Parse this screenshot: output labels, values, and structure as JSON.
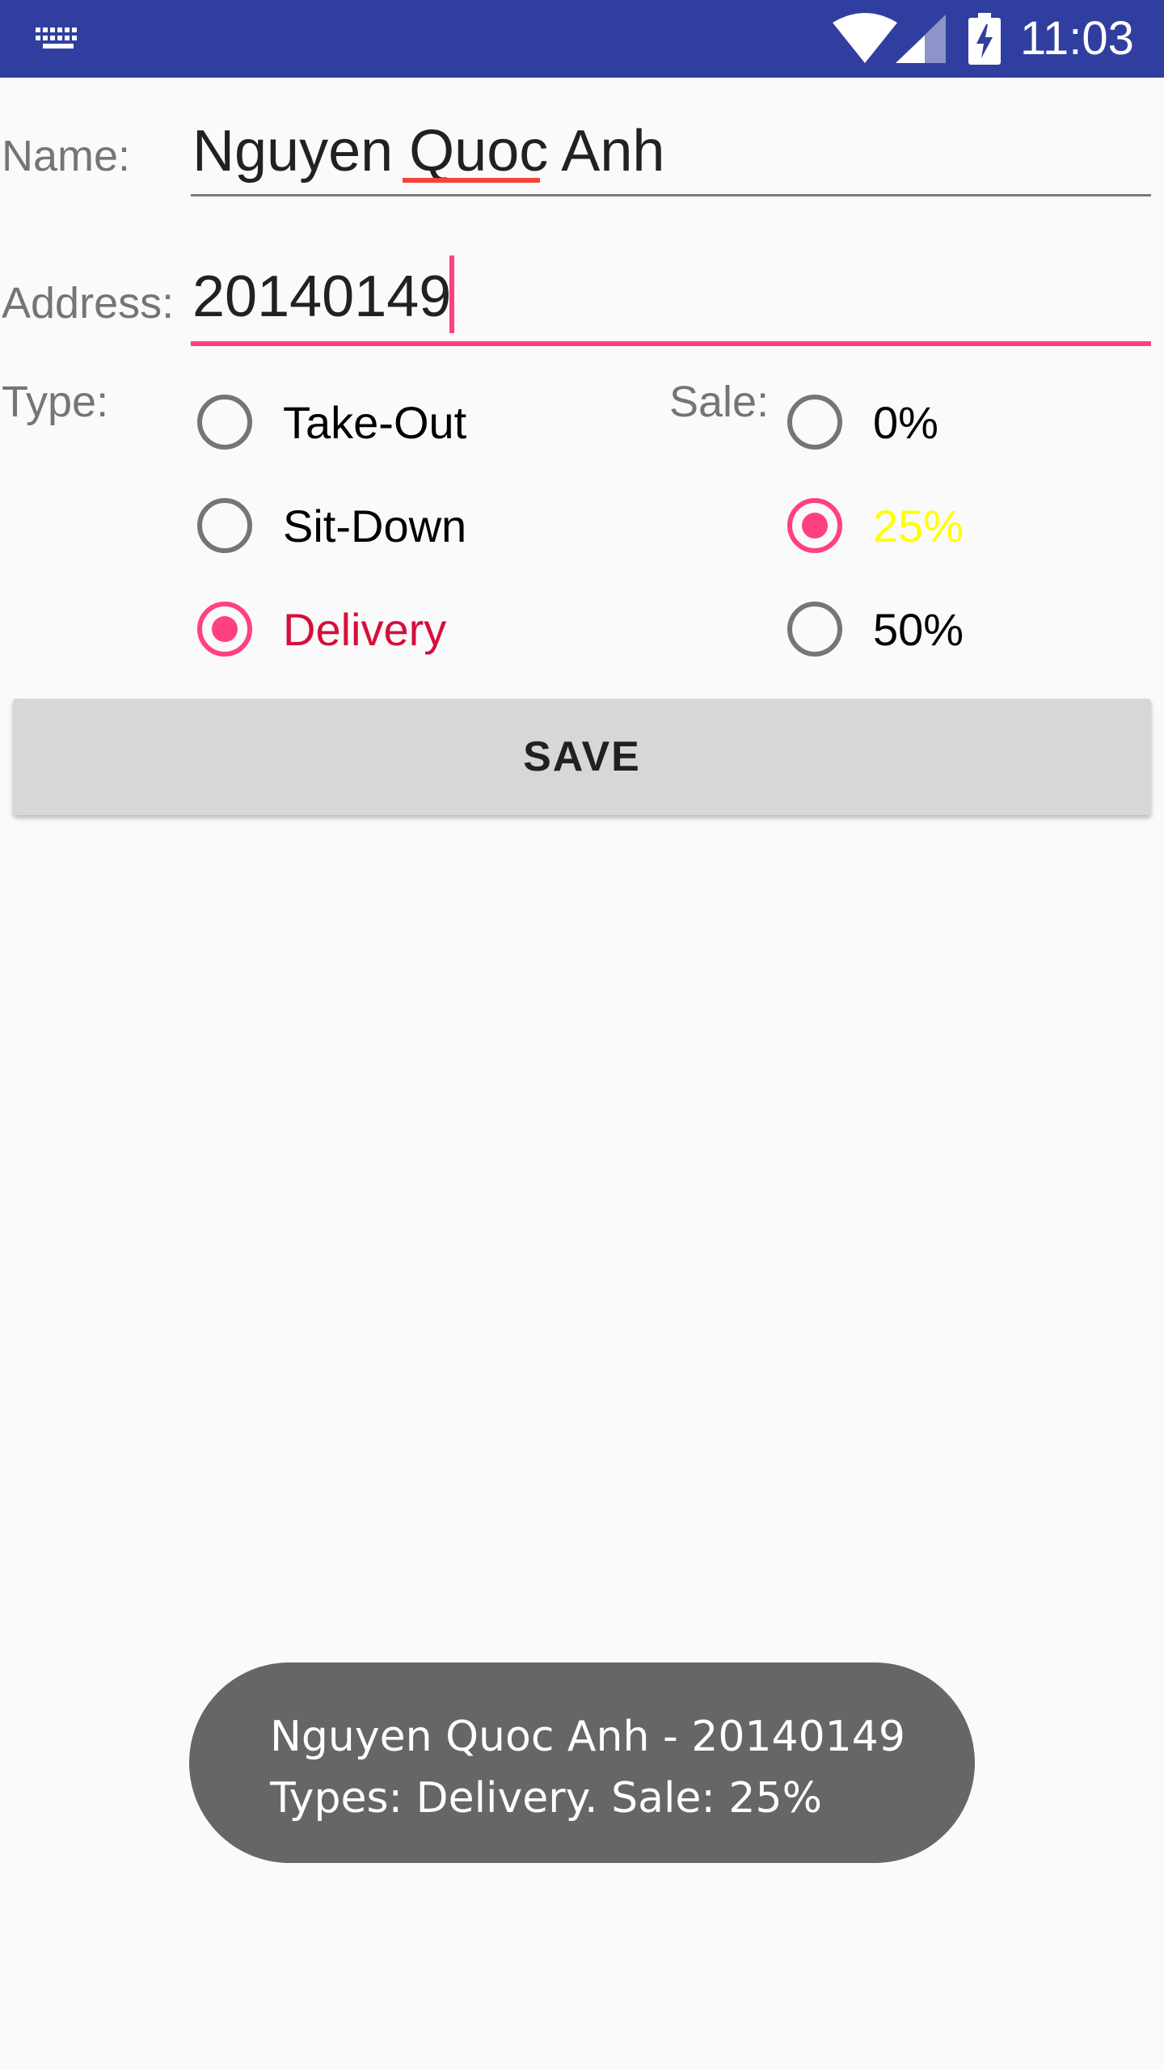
{
  "status_bar": {
    "time": "11:03",
    "icons": [
      "keyboard-icon",
      "wifi-icon",
      "cell-signal-icon",
      "battery-charging-icon"
    ],
    "background": "#303f9f"
  },
  "form": {
    "name_label": "Name:",
    "name_value": "Nguyen Quoc Anh",
    "address_label": "Address:",
    "address_value": "20140149",
    "type_label": "Type:",
    "sale_label": "Sale:",
    "type_options": [
      {
        "label": "Take-Out",
        "checked": false
      },
      {
        "label": "Sit-Down",
        "checked": false
      },
      {
        "label": "Delivery",
        "checked": true,
        "color": "#d50f3a"
      }
    ],
    "sale_options": [
      {
        "label": "0%",
        "checked": false
      },
      {
        "label": "25%",
        "checked": true,
        "color": "#ffff00"
      },
      {
        "label": "50%",
        "checked": false
      }
    ],
    "save_label": "SAVE"
  },
  "toast": {
    "line1": "Nguyen Quoc Anh - 20140149",
    "line2": "Types: Delivery. Sale: 25%"
  },
  "colors": {
    "accent": "#ff4081",
    "background": "#fafafa",
    "toast_bg": "#666666"
  }
}
